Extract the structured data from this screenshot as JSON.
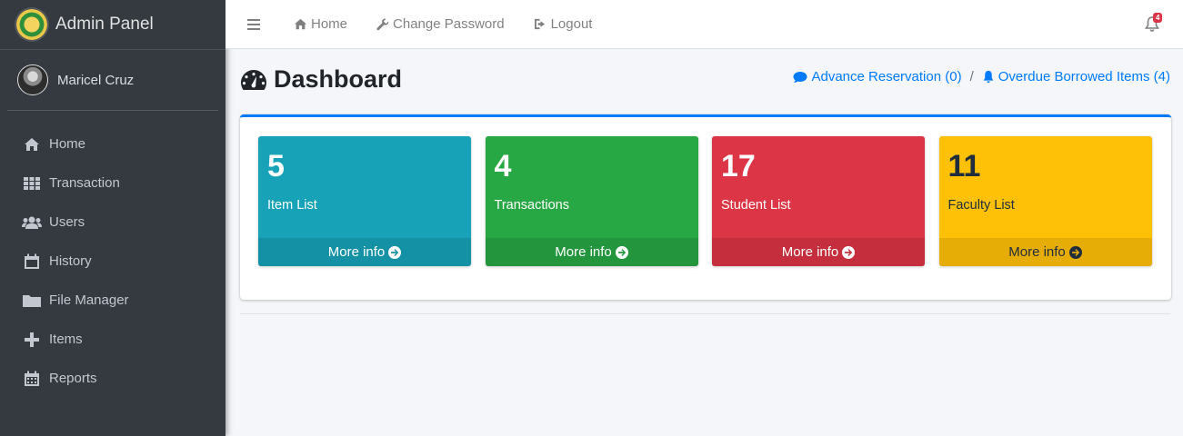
{
  "brand": {
    "title": "Admin Panel"
  },
  "user": {
    "name": "Maricel Cruz"
  },
  "sidebar": {
    "items": [
      {
        "label": "Home",
        "icon": "home-icon"
      },
      {
        "label": "Transaction",
        "icon": "grid-icon"
      },
      {
        "label": "Users",
        "icon": "users-icon"
      },
      {
        "label": "History",
        "icon": "calendar-icon"
      },
      {
        "label": "File Manager",
        "icon": "folder-icon"
      },
      {
        "label": "Items",
        "icon": "plus-icon"
      },
      {
        "label": "Reports",
        "icon": "calendar-grid-icon"
      }
    ]
  },
  "topbar": {
    "home": "Home",
    "change_password": "Change Password",
    "logout": "Logout",
    "notification_count": "4"
  },
  "header": {
    "title": "Dashboard",
    "advance_reservation": "Advance Reservation (0)",
    "separator": "/",
    "overdue_items": "Overdue Borrowed Items (4)"
  },
  "boxes": [
    {
      "value": "5",
      "label": "Item List",
      "footer": "More info",
      "color": "#17a2b8"
    },
    {
      "value": "4",
      "label": "Transactions",
      "footer": "More info",
      "color": "#28a745"
    },
    {
      "value": "17",
      "label": "Student List",
      "footer": "More info",
      "color": "#dc3545"
    },
    {
      "value": "11",
      "label": "Faculty List",
      "footer": "More info",
      "color": "#ffc107"
    }
  ],
  "colors": {
    "sidebar": "#343a40",
    "accent": "#007bff",
    "background": "#f4f6f9"
  }
}
